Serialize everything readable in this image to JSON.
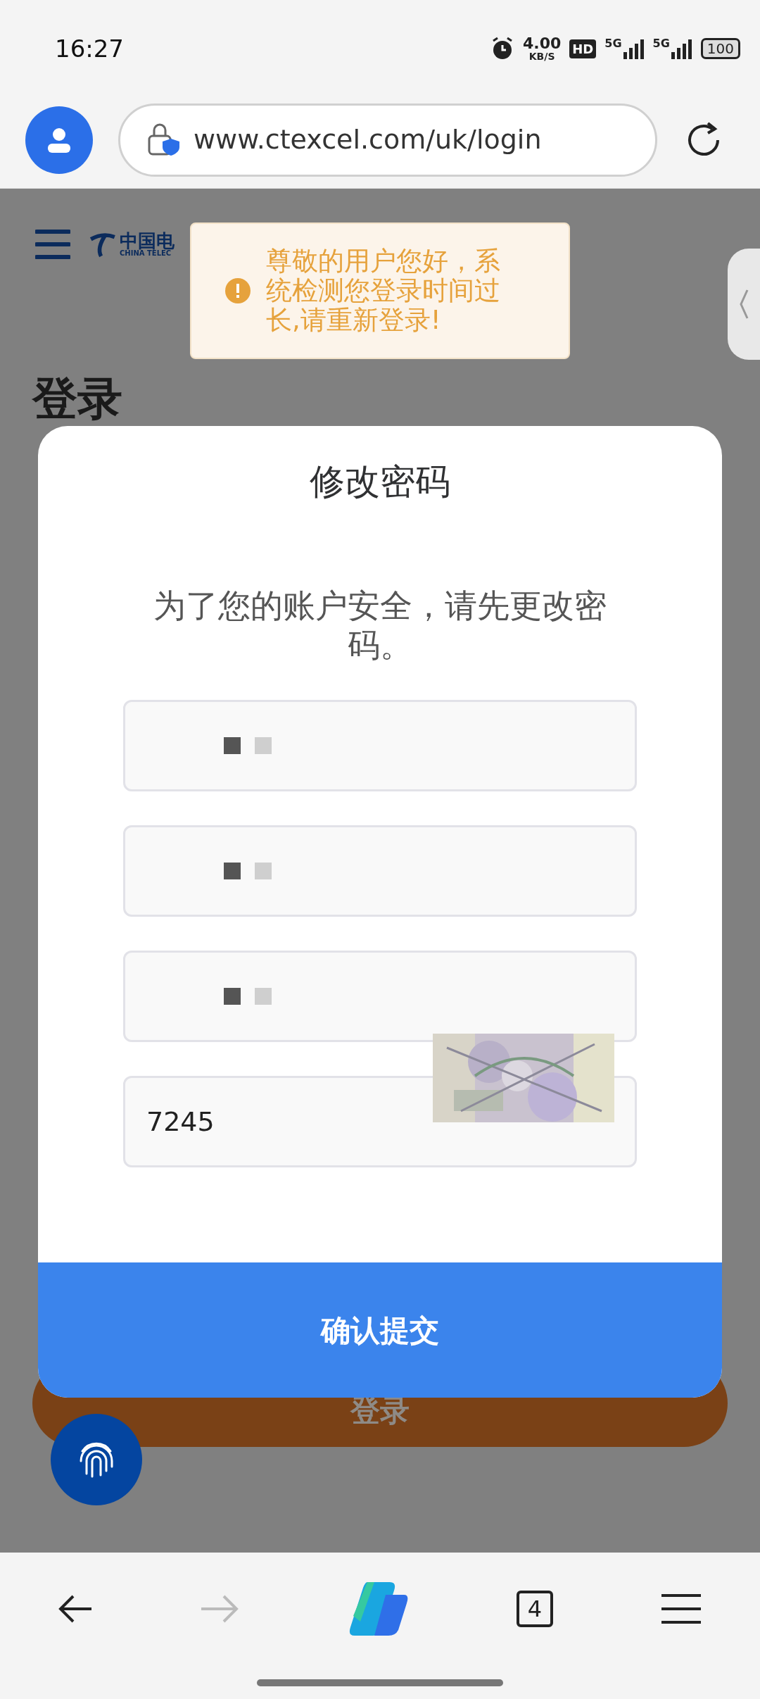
{
  "status_bar": {
    "time": "16:27",
    "net_speed": "4.00",
    "net_speed_unit": "KB/S",
    "hd_badge": "HD",
    "signal_1": "5G",
    "signal_2": "5G",
    "battery": "100"
  },
  "browser": {
    "url": "www.ctexcel.com/uk/login",
    "tab_count": "4",
    "forward_disabled": true
  },
  "page": {
    "logo_cn": "中国电",
    "logo_en": "CHINA TELEC",
    "heading": "登录",
    "login_button": "登录"
  },
  "toast": {
    "message": "尊敬的用户您好，系统检测您登录时间过长,请重新登录!"
  },
  "dialog": {
    "title": "修改密码",
    "message": "为了您的账户安全，请先更改密码。",
    "fields": [
      {
        "kind": "masked"
      },
      {
        "kind": "masked"
      },
      {
        "kind": "masked"
      },
      {
        "kind": "captcha",
        "value": "7245"
      }
    ],
    "submit": "确认提交"
  }
}
